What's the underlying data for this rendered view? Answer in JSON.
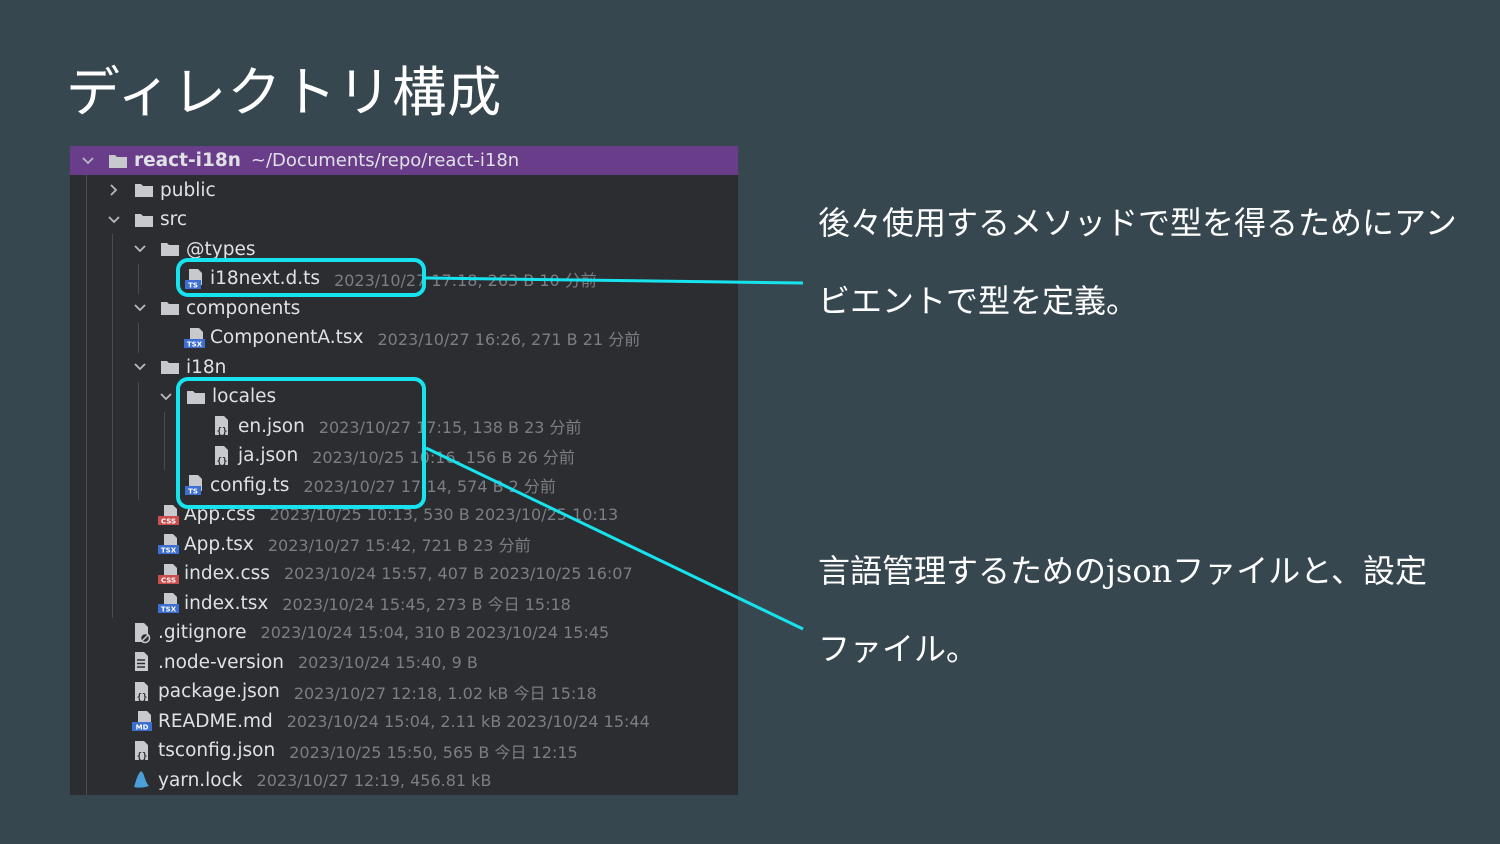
{
  "slide": {
    "title": "ディレクトリ構成"
  },
  "tree": {
    "root": {
      "name": "react-i18n",
      "path": "~/Documents/repo/react-i18n"
    },
    "rows": [
      {
        "name": "public",
        "meta": ""
      },
      {
        "name": "src",
        "meta": ""
      },
      {
        "name": "@types",
        "meta": ""
      },
      {
        "name": "i18next.d.ts",
        "meta": "2023/10/27 17:18, 263 B 10 分前",
        "icon": "ts-file-icon",
        "icon_label": "TS"
      },
      {
        "name": "components",
        "meta": ""
      },
      {
        "name": "ComponentA.tsx",
        "meta": "2023/10/27 16:26, 271 B 21 分前",
        "icon": "tsx-file-icon",
        "icon_label": "TSX"
      },
      {
        "name": "i18n",
        "meta": ""
      },
      {
        "name": "locales",
        "meta": ""
      },
      {
        "name": "en.json",
        "meta": "2023/10/27 17:15, 138 B 23 分前",
        "icon": "json-file-icon",
        "icon_label": "{}"
      },
      {
        "name": "ja.json",
        "meta": "2023/10/25 10:16, 156 B 26 分前",
        "icon": "json-file-icon",
        "icon_label": "{}"
      },
      {
        "name": "config.ts",
        "meta": "2023/10/27 17:14, 574 B 2 分前",
        "icon": "ts-file-icon",
        "icon_label": "TS"
      },
      {
        "name": "App.css",
        "meta": "2023/10/25 10:13, 530 B 2023/10/25 10:13",
        "icon": "css-file-icon",
        "icon_label": "CSS"
      },
      {
        "name": "App.tsx",
        "meta": "2023/10/27 15:42, 721 B 23 分前",
        "icon": "tsx-file-icon",
        "icon_label": "TSX"
      },
      {
        "name": "index.css",
        "meta": "2023/10/24 15:57, 407 B 2023/10/25 16:07",
        "icon": "css-file-icon",
        "icon_label": "CSS"
      },
      {
        "name": "index.tsx",
        "meta": "2023/10/24 15:45, 273 B 今日 15:18",
        "icon": "tsx-file-icon",
        "icon_label": "TSX"
      },
      {
        "name": ".gitignore",
        "meta": "2023/10/24 15:04, 310 B 2023/10/24 15:45",
        "icon": "gitignore-file-icon",
        "icon_label": ""
      },
      {
        "name": ".node-version",
        "meta": "2023/10/24 15:40, 9 B",
        "icon": "text-file-icon",
        "icon_label": ""
      },
      {
        "name": "package.json",
        "meta": "2023/10/27 12:18, 1.02 kB 今日 15:18",
        "icon": "json-file-icon",
        "icon_label": "{}"
      },
      {
        "name": "README.md",
        "meta": "2023/10/24 15:04, 2.11 kB 2023/10/24 15:44",
        "icon": "md-file-icon",
        "icon_label": "MD"
      },
      {
        "name": "tsconfig.json",
        "meta": "2023/10/25 15:50, 565 B 今日 12:15",
        "icon": "json-file-icon",
        "icon_label": "{}"
      },
      {
        "name": "yarn.lock",
        "meta": "2023/10/27 12:19, 456.81 kB",
        "icon": "yarn-file-icon",
        "icon_label": ""
      }
    ]
  },
  "notes": {
    "types_note": "後々使用するメソッドで型を得るためにアンビエントで型を定義。",
    "i18n_note": "言語管理するためのjsonファイルと、設定ファイル。"
  },
  "colors": {
    "background": "#37474f",
    "tree_background": "#2b2d30",
    "root_highlight": "#693d8a",
    "callout": "#17e3ee"
  }
}
